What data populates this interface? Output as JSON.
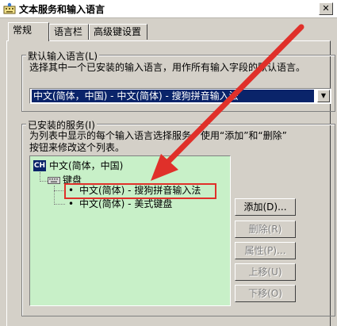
{
  "window": {
    "title": "文本服务和输入语言",
    "close_glyph": "✕"
  },
  "tabs": [
    {
      "label": "常规",
      "active": true
    },
    {
      "label": "语言栏",
      "active": false
    },
    {
      "label": "高级键设置",
      "active": false
    }
  ],
  "default_language": {
    "group_title": "默认输入语言(L)",
    "description": "选择其中一个已安装的输入语言，用作所有输入字段的默认语言。",
    "selected_value": "中文(简体，中国) - 中文(简体) - 搜狗拼音输入法",
    "dropdown_glyph": "▼"
  },
  "installed_services": {
    "group_title": "已安装的服务(I)",
    "description_line1": "为列表中显示的每个输入语言选择服务。使用“添加”和“删除”",
    "description_line2": "按钮来修改这个列表。",
    "tree": {
      "language_badge": "CH",
      "language": "中文(简体，中国)",
      "category": "键盘",
      "items": [
        {
          "label": "中文(简体) - 搜狗拼音输入法",
          "highlighted": true
        },
        {
          "label": "中文(简体) - 美式键盘",
          "highlighted": false
        }
      ],
      "bullet": "•"
    }
  },
  "buttons": {
    "add": "添加(D)...",
    "remove": "删除(R)",
    "properties": "属性(P)...",
    "move_up": "上移(U)",
    "move_down": "下移(O)"
  },
  "colors": {
    "window_bg": "#d4d0c8",
    "selection": "#0a246a",
    "tree_bg": "#c8f0c8",
    "annotation_red": "#e0302a"
  }
}
